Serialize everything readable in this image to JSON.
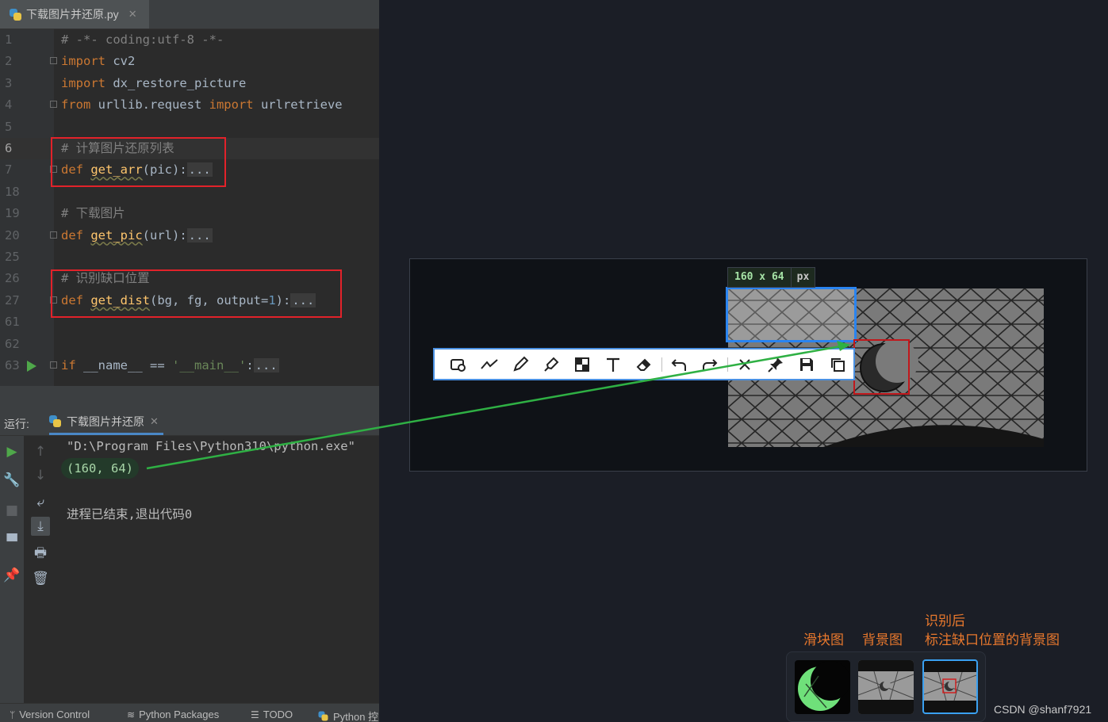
{
  "editor": {
    "file_tab": {
      "label": "下载图片并还原.py",
      "close": "✕"
    },
    "lines": [
      {
        "num": "1",
        "segs": [
          [
            "cm",
            "# -*- coding:utf-8 -*-"
          ]
        ]
      },
      {
        "num": "2",
        "fold": true,
        "segs": [
          [
            "kw",
            "import"
          ],
          [
            "pl",
            " cv2"
          ]
        ]
      },
      {
        "num": "3",
        "segs": [
          [
            "kw",
            "import"
          ],
          [
            "pl",
            " dx_restore_picture"
          ]
        ]
      },
      {
        "num": "4",
        "fold": true,
        "segs": [
          [
            "kw",
            "from"
          ],
          [
            "pl",
            " urllib.request "
          ],
          [
            "kw",
            "import"
          ],
          [
            "pl",
            " urlretrieve"
          ]
        ]
      },
      {
        "num": "5",
        "segs": []
      },
      {
        "num": "6",
        "current": true,
        "segs": [
          [
            "cm",
            "# 计算图片还原列表"
          ]
        ]
      },
      {
        "num": "7",
        "fold": true,
        "segs": [
          [
            "kw",
            "def"
          ],
          [
            "pl",
            " "
          ],
          [
            "fn",
            "get_arr"
          ],
          [
            "pl",
            "(pic):"
          ],
          [
            "ell",
            "..."
          ]
        ]
      },
      {
        "num": "18",
        "segs": []
      },
      {
        "num": "19",
        "segs": [
          [
            "cm",
            "# 下载图片"
          ]
        ]
      },
      {
        "num": "20",
        "fold": true,
        "segs": [
          [
            "kw",
            "def"
          ],
          [
            "pl",
            " "
          ],
          [
            "fn",
            "get_pic"
          ],
          [
            "pl",
            "(url):"
          ],
          [
            "ell",
            "..."
          ]
        ]
      },
      {
        "num": "25",
        "segs": []
      },
      {
        "num": "26",
        "segs": [
          [
            "cm",
            "# 识别缺口位置"
          ]
        ]
      },
      {
        "num": "27",
        "fold": true,
        "segs": [
          [
            "kw",
            "def"
          ],
          [
            "pl",
            " "
          ],
          [
            "fn",
            "get_dist"
          ],
          [
            "pl",
            "(bg, fg, output="
          ],
          [
            "num",
            "1"
          ],
          [
            "pl",
            "):"
          ],
          [
            "ell",
            "..."
          ]
        ]
      },
      {
        "num": "61",
        "segs": []
      },
      {
        "num": "62",
        "segs": []
      },
      {
        "num": "63",
        "fold": true,
        "run": true,
        "segs": [
          [
            "kw",
            "if"
          ],
          [
            "pl",
            " __name__ == "
          ],
          [
            "str",
            "'__main__'"
          ],
          [
            "pl",
            ":"
          ],
          [
            "ell",
            "..."
          ]
        ]
      }
    ]
  },
  "run_panel": {
    "label": "运行:",
    "tab_label": "下载图片并还原",
    "tab_close": "✕",
    "command": "\"D:\\Program Files\\Python310\\python.exe\"",
    "result": "(160, 64)",
    "exit_message": "进程已结束,退出代码0"
  },
  "status_bar": {
    "version_control": "Version Control",
    "python_packages": "Python Packages",
    "todo": "TODO",
    "python_console": "Python 控"
  },
  "screenshot_tool": {
    "size_value": "160 x 64",
    "size_unit": "px"
  },
  "captions": {
    "slider": "滑块图",
    "background": "背景图",
    "marked_line1": "识别后",
    "marked_line2": "标注缺口位置的背景图"
  },
  "watermark": "CSDN @shanf7921",
  "colors": {
    "highlight_red": "#e2222a",
    "selection_blue": "#2a84f0",
    "arrow_green": "#2fb044",
    "caption_orange": "#e8782d"
  }
}
